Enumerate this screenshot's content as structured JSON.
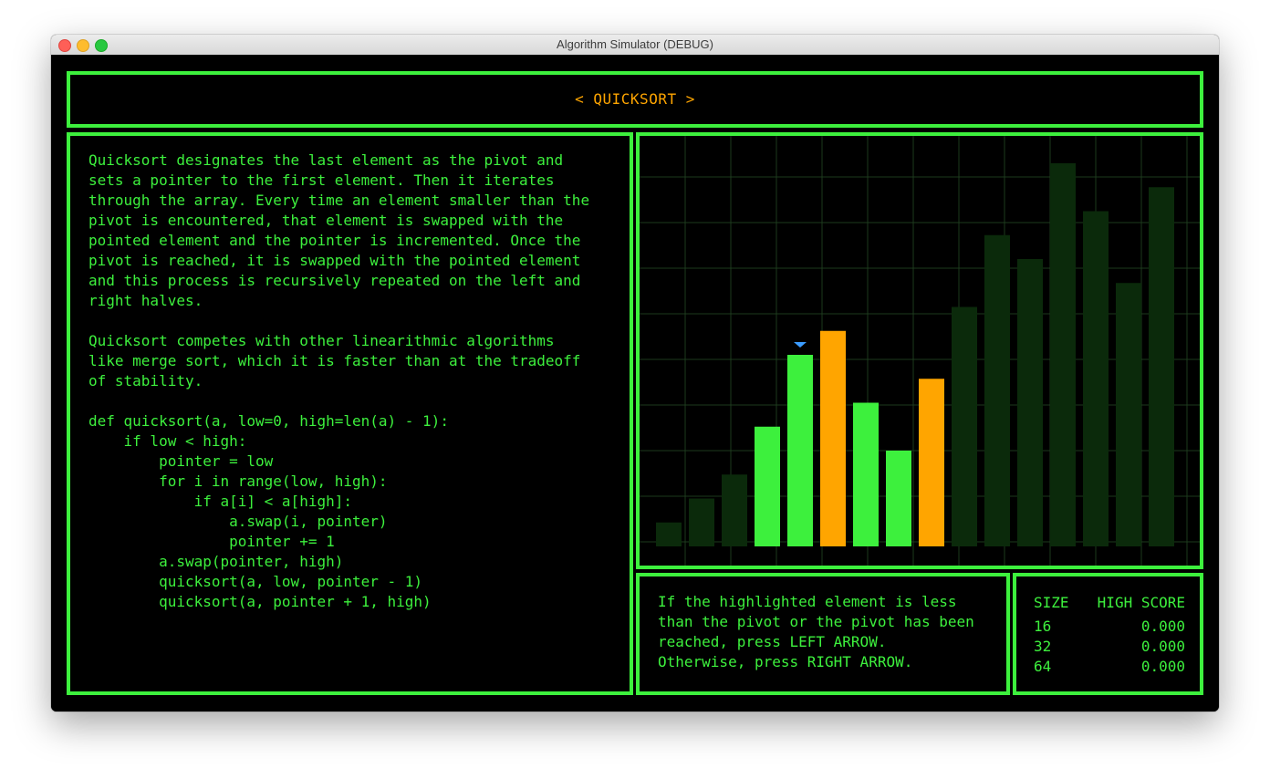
{
  "window": {
    "title": "Algorithm Simulator (DEBUG)"
  },
  "header": {
    "title": "< QUICKSORT >"
  },
  "description": {
    "text": "Quicksort designates the last element as the pivot and\nsets a pointer to the first element. Then it iterates\nthrough the array. Every time an element smaller than the\npivot is encountered, that element is swapped with the\npointed element and the pointer is incremented. Once the\npivot is reached, it is swapped with the pointed element\nand this process is recursively repeated on the left and\nright halves.\n\nQuicksort competes with other linearithmic algorithms\nlike merge sort, which it is faster than at the tradeoff\nof stability.\n\ndef quicksort(a, low=0, high=len(a) - 1):\n    if low < high:\n        pointer = low\n        for i in range(low, high):\n            if a[i] < a[high]:\n                a.swap(i, pointer)\n                pointer += 1\n        a.swap(pointer, high)\n        quicksort(a, low, pointer - 1)\n        quicksort(a, pointer + 1, high)"
  },
  "prompt": {
    "text": "If the highlighted element is less\nthan the pivot or the pivot has been\nreached, press LEFT ARROW.\nOtherwise, press RIGHT ARROW."
  },
  "scores": {
    "size_header": "SIZE",
    "score_header": "HIGH SCORE",
    "rows": [
      {
        "size": "16",
        "score": "0.000"
      },
      {
        "size": "32",
        "score": "0.000"
      },
      {
        "size": "64",
        "score": "0.000"
      }
    ]
  },
  "colors": {
    "accent": "#3df03d",
    "pivot": "#ffa500",
    "inactive": "#0b2a0b",
    "grid": "#1d3a1d",
    "marker": "#3b9cff"
  },
  "chart_data": {
    "type": "bar",
    "ylim": [
      0,
      16
    ],
    "grid": true,
    "values": [
      1,
      2,
      3,
      5,
      8,
      9,
      6,
      4,
      7,
      10,
      13,
      12,
      16,
      14,
      11,
      15
    ],
    "states": [
      "inactive",
      "inactive",
      "inactive",
      "active",
      "active",
      "pivot",
      "active",
      "active",
      "pivot",
      "inactive",
      "inactive",
      "inactive",
      "inactive",
      "inactive",
      "inactive",
      "inactive"
    ],
    "pointer_index": 4
  }
}
